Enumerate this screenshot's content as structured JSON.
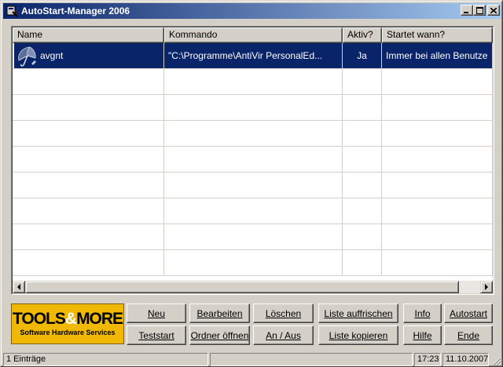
{
  "window": {
    "title": "AutoStart-Manager 2006",
    "controls": {
      "minimize": "_",
      "maximize": "□",
      "close": "×"
    }
  },
  "list": {
    "columns": [
      "Name",
      "Kommando",
      "Aktiv?",
      "Startet wann?"
    ],
    "rows": [
      {
        "name": "avgnt",
        "icon": "antivir-umbrella-icon",
        "kommando": "\"C:\\Programme\\AntiVir PersonalEd...",
        "aktiv": "Ja",
        "startet": "Immer bei allen Benutze",
        "selected": true
      }
    ],
    "empty_rows": 8
  },
  "logo": {
    "line1_a": "TOOLS",
    "line1_amp": "&",
    "line1_b": "MORE",
    "line2": "Software Hardware Services"
  },
  "buttons": {
    "neu": "Neu",
    "bearbeiten": "Bearbeiten",
    "loeschen": "Löschen",
    "liste_auffrischen": "Liste auffrischen",
    "info": "Info",
    "autostart": "Autostart",
    "teststart": "Teststart",
    "ordner_oeffnen": "Ordner öffnen",
    "an_aus": "An / Aus",
    "liste_kopieren": "Liste kopieren",
    "hilfe": "Hilfe",
    "ende": "Ende"
  },
  "status": {
    "entries": "1 Einträge",
    "time": "17:23",
    "date": "11.10.2007"
  },
  "colors": {
    "titlebar_start": "#0a246a",
    "titlebar_end": "#a6caf0",
    "selection": "#0a246a",
    "logo_bg": "#f0b800",
    "face": "#d4d0c8"
  }
}
